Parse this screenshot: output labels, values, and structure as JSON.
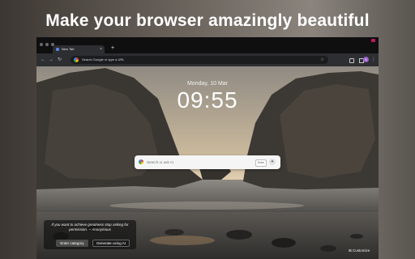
{
  "headline": "Make your browser amazingly beautiful",
  "tab": {
    "title": "New Tab",
    "close": "×",
    "new_tab": "+"
  },
  "toolbar": {
    "back": "←",
    "forward": "→",
    "reload": "↻",
    "omnibox_text": "Search Google or type a URL",
    "star": "☆",
    "avatar_initial": "S",
    "menu": "⋮"
  },
  "newtab": {
    "date": "Monday, 10 Mar",
    "time": "09:55",
    "search_placeholder": "Search or ask AI",
    "enter_label": "Enter"
  },
  "quote": {
    "text": "If you want to achieve greatness stop asking for permission. ~ Anonymous",
    "enter_category": "Enter category",
    "generate_ai": "Generate using AI"
  },
  "customize_label": "Customize",
  "colors": {
    "accent": "#5e8cf0",
    "avatar": "#9c5fd0",
    "window_button": "#c2185b"
  }
}
